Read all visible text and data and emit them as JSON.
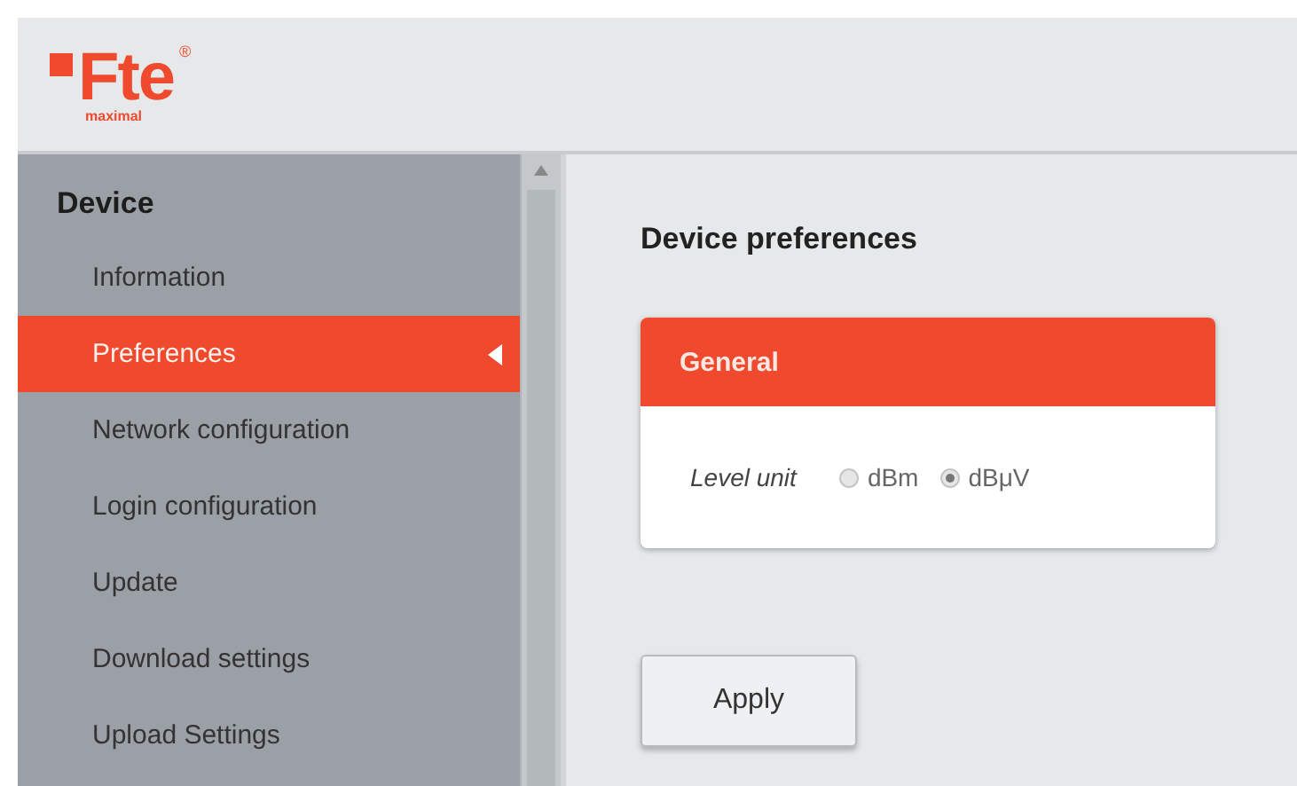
{
  "logo": {
    "name": "Fte",
    "tagline": "maximal",
    "mark": "®"
  },
  "sidebar": {
    "section": "Device",
    "items": [
      {
        "label": "Information",
        "selected": false
      },
      {
        "label": "Preferences",
        "selected": true
      },
      {
        "label": "Network configuration",
        "selected": false
      },
      {
        "label": "Login configuration",
        "selected": false
      },
      {
        "label": "Update",
        "selected": false
      },
      {
        "label": "Download settings",
        "selected": false
      },
      {
        "label": "Upload Settings",
        "selected": false
      }
    ]
  },
  "content": {
    "title": "Device preferences",
    "panel": {
      "title": "General",
      "field": {
        "label": "Level unit",
        "options": [
          {
            "label": "dBm",
            "selected": false
          },
          {
            "label": "dBμV",
            "selected": true
          }
        ]
      }
    },
    "buttons": [
      "Apply"
    ]
  }
}
